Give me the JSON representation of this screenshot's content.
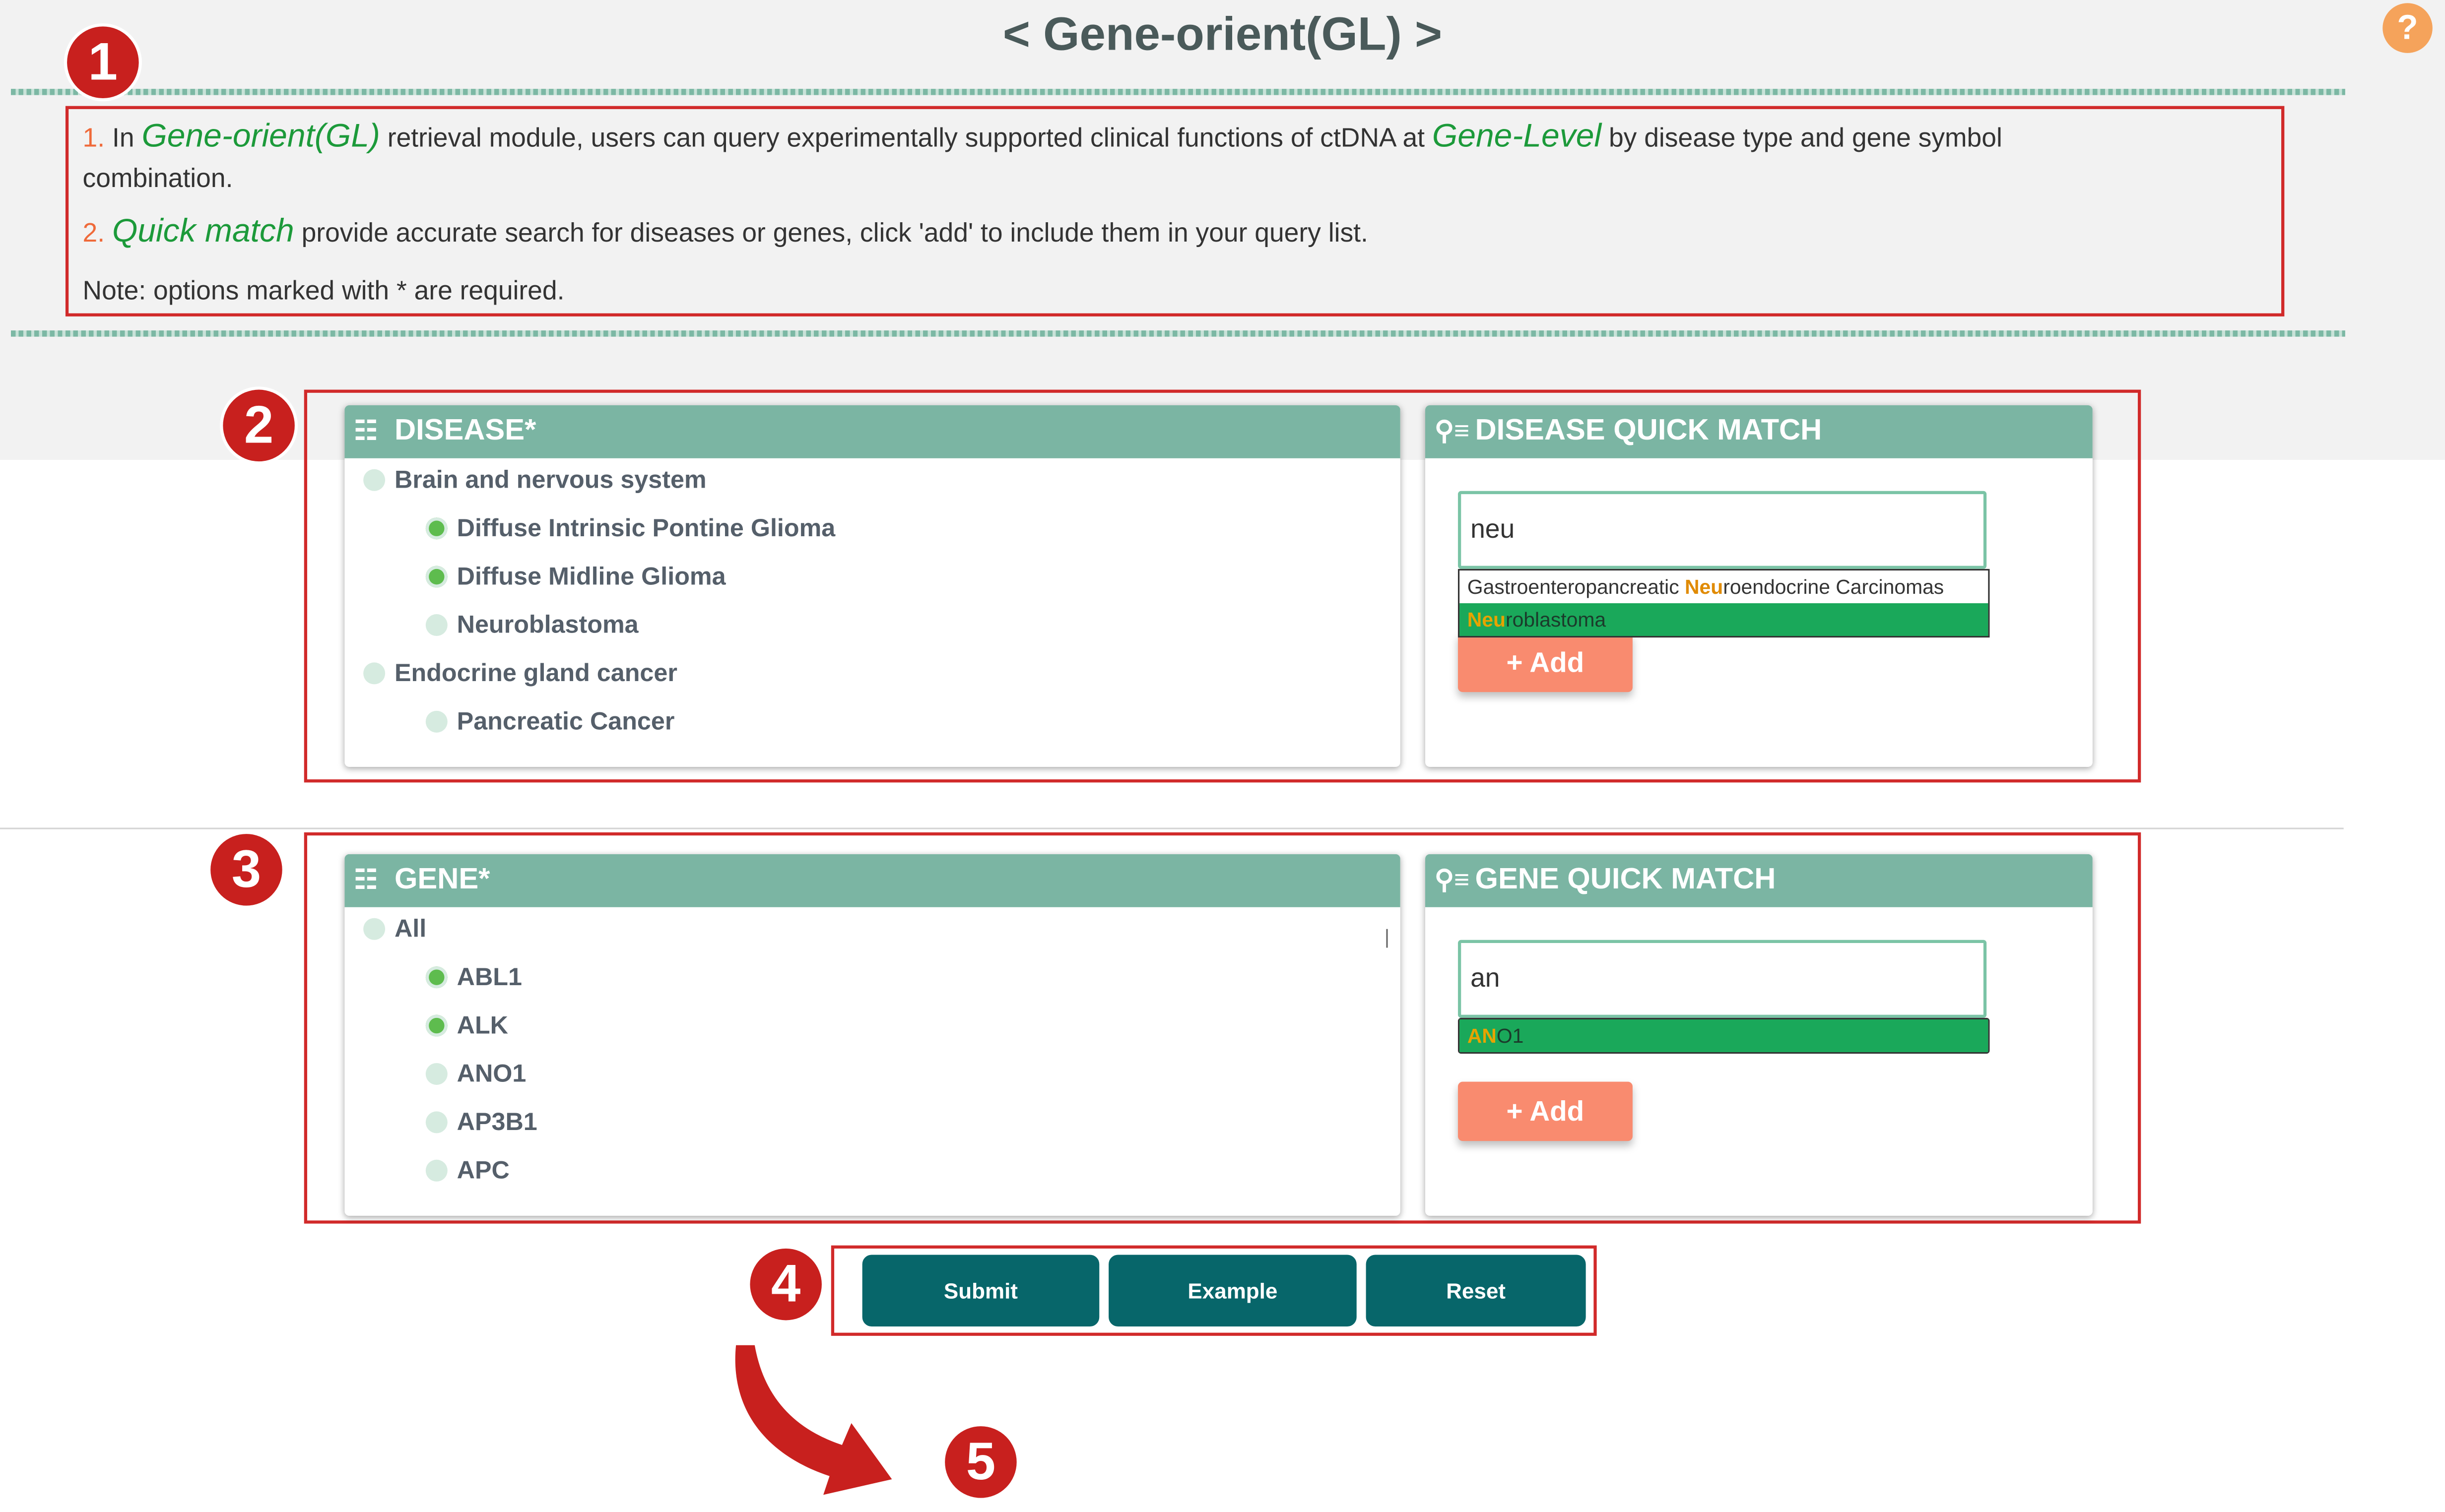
{
  "header": {
    "title": "< Gene-orient(GL) >",
    "help_icon": "question-circle-icon",
    "help_glyph": "?"
  },
  "callouts": [
    "1",
    "2",
    "3",
    "4",
    "5"
  ],
  "intro": {
    "line1": {
      "num": "1.",
      "pre": "In",
      "em1": "Gene-orient(GL)",
      "mid": "retrieval module, users can query experimentally supported clinical functions of ctDNA at",
      "em2": "Gene-Level",
      "post": "by disease type and gene symbol",
      "cont": "combination."
    },
    "line2": {
      "num": "2.",
      "em": "Quick match",
      "rest": "provide accurate search for diseases or genes, click 'add' to include them in your query list."
    },
    "note": "Note: options marked with * are required."
  },
  "disease_panel": {
    "header": "DISEASE*",
    "icon": "list-tree-icon",
    "items": [
      {
        "label": "Brain and nervous system",
        "selected": false
      },
      {
        "label": "Diffuse Intrinsic Pontine Glioma",
        "selected": true
      },
      {
        "label": "Diffuse Midline Glioma",
        "selected": true
      },
      {
        "label": "Neuroblastoma",
        "selected": false
      },
      {
        "label": "Endocrine gland cancer",
        "selected": false
      },
      {
        "label": "Pancreatic Cancer",
        "selected": false
      }
    ]
  },
  "disease_quick": {
    "header": "DISEASE QUICK MATCH",
    "icon": "search-list-icon",
    "input_value": "neu",
    "suggestions": [
      {
        "pre": "Gastroenteropancreatic ",
        "match": "Neu",
        "post": "roendocrine Carcinomas",
        "highlighted": false
      },
      {
        "pre": "",
        "match": "Neu",
        "post": "roblastoma",
        "highlighted": true
      }
    ],
    "add_label": "Add",
    "add_glyph": "+"
  },
  "gene_panel": {
    "header": "GENE*",
    "icon": "list-tree-icon",
    "items": [
      {
        "label": "All",
        "selected": false
      },
      {
        "label": "ABL1",
        "selected": true
      },
      {
        "label": "ALK",
        "selected": true
      },
      {
        "label": "ANO1",
        "selected": false
      },
      {
        "label": "AP3B1",
        "selected": false
      },
      {
        "label": "APC",
        "selected": false
      }
    ]
  },
  "gene_quick": {
    "header": "GENE QUICK MATCH",
    "icon": "search-list-icon",
    "input_value": "an",
    "suggestions": [
      {
        "pre": "",
        "match": "AN",
        "post": "O1",
        "highlighted": true
      }
    ],
    "add_label": "Add",
    "add_glyph": "+"
  },
  "actions": {
    "submit": "Submit",
    "example": "Example",
    "reset": "Reset"
  },
  "colors": {
    "panel_header": "#7bb5a3",
    "callout": "#c8201e",
    "add_button": "#f98b6f",
    "action_button": "#07666a",
    "match_highlight": "#1aa85a"
  }
}
